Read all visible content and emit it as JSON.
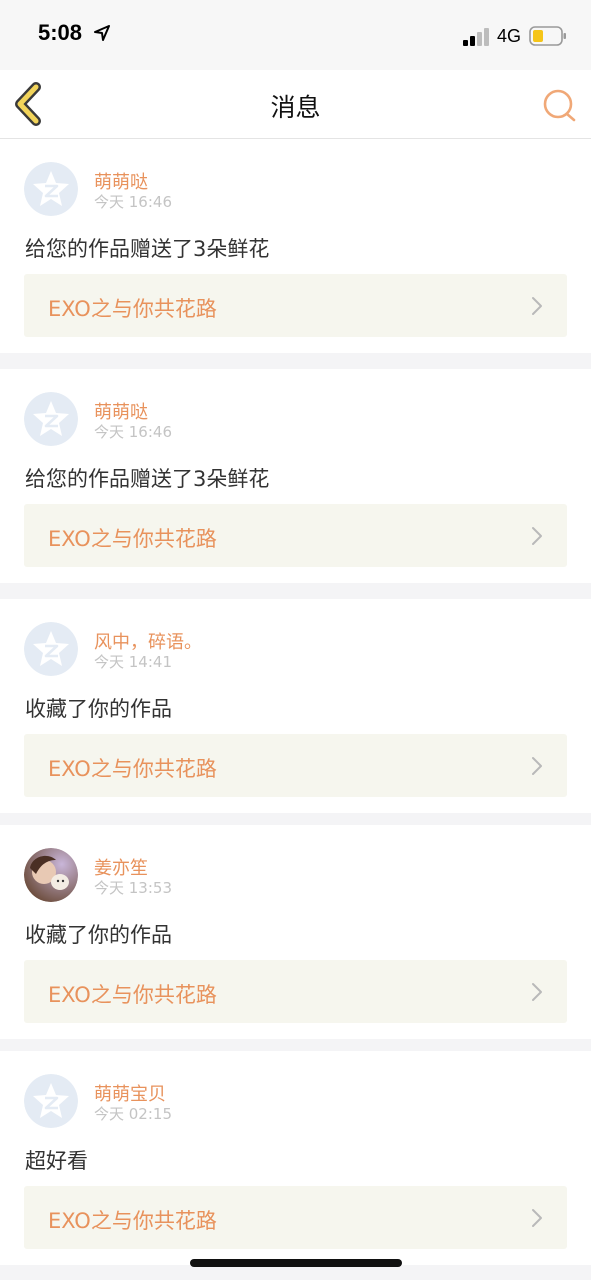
{
  "status_bar": {
    "time": "5:08",
    "network": "4G",
    "icons": [
      "location-arrow-icon",
      "signal-icon",
      "battery-icon"
    ]
  },
  "nav": {
    "title": "消息",
    "back_icon": "chevron-left-icon",
    "search_icon": "search-icon",
    "accent_color": "#e8925c",
    "back_color": "#f2d45a"
  },
  "messages": [
    {
      "username": "萌萌哒",
      "time": "今天 16:46",
      "text": "给您的作品赠送了3朵鲜花",
      "work": "EXO之与你共花路",
      "avatar": "default-avatar-icon"
    },
    {
      "username": "萌萌哒",
      "time": "今天 16:46",
      "text": "给您的作品赠送了3朵鲜花",
      "work": "EXO之与你共花路",
      "avatar": "default-avatar-icon"
    },
    {
      "username": "风中，碎语。",
      "time": "今天 14:41",
      "text": "收藏了你的作品",
      "work": "EXO之与你共花路",
      "avatar": "default-avatar-icon"
    },
    {
      "username": "姜亦笙",
      "time": "今天 13:53",
      "text": "收藏了你的作品",
      "work": "EXO之与你共花路",
      "avatar": "photo-avatar"
    },
    {
      "username": "萌萌宝贝",
      "time": "今天 02:15",
      "text": "超好看",
      "work": "EXO之与你共花路",
      "avatar": "default-avatar-icon"
    }
  ]
}
